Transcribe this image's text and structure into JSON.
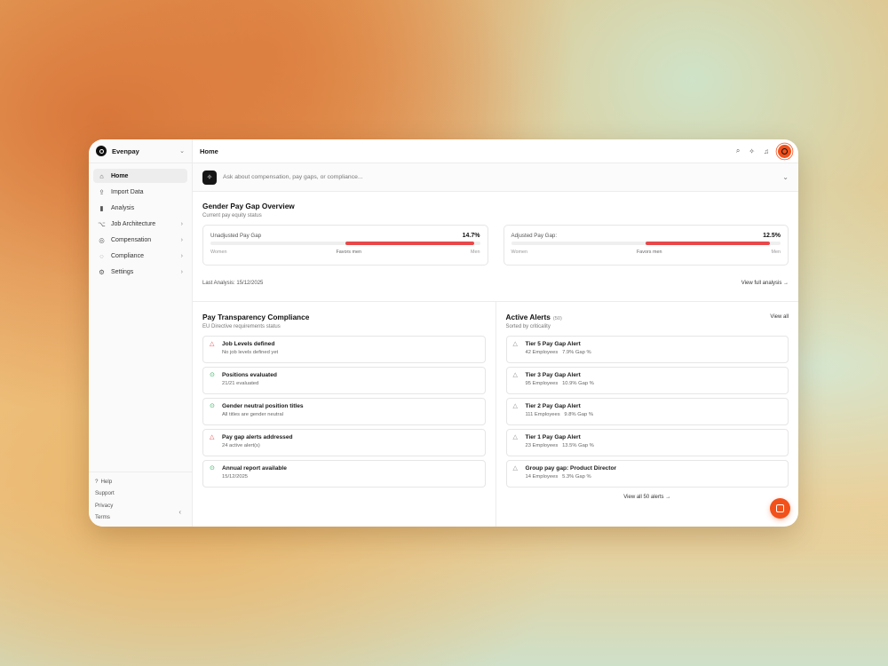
{
  "brand": {
    "name": "Evenpay"
  },
  "sidebar": {
    "items": [
      {
        "label": "Home",
        "icon": "home-icon",
        "glyph": "⌂",
        "active": true,
        "has_children": false
      },
      {
        "label": "Import Data",
        "icon": "upload-icon",
        "glyph": "⇪",
        "active": false,
        "has_children": false
      },
      {
        "label": "Analysis",
        "icon": "bar-chart-icon",
        "glyph": "▮",
        "active": false,
        "has_children": false
      },
      {
        "label": "Job Architecture",
        "icon": "flow-icon",
        "glyph": "⌥",
        "active": false,
        "has_children": true
      },
      {
        "label": "Compensation",
        "icon": "coin-icon",
        "glyph": "◎",
        "active": false,
        "has_children": true
      },
      {
        "label": "Compliance",
        "icon": "check-circle-icon",
        "glyph": "◌",
        "active": false,
        "has_children": true
      },
      {
        "label": "Settings",
        "icon": "gear-icon",
        "glyph": "⚙",
        "active": false,
        "has_children": true
      }
    ],
    "footer": {
      "help": "Help",
      "support": "Support",
      "privacy": "Privacy",
      "terms": "Terms"
    }
  },
  "header": {
    "title": "Home"
  },
  "ask": {
    "placeholder": "Ask about compensation, pay gaps, or compliance..."
  },
  "overview": {
    "title": "Gender Pay Gap Overview",
    "subtitle": "Current pay equity status",
    "cards": [
      {
        "label": "Unadjusted Pay Gap",
        "value": "14.7%",
        "fill_from": 0.5,
        "fill_to": 0.98,
        "left": "Women",
        "mid": "Favors men",
        "right": "Men"
      },
      {
        "label": "Adjusted Pay Gap:",
        "value": "12.5%",
        "fill_from": 0.5,
        "fill_to": 0.96,
        "left": "Women",
        "mid": "Favors men",
        "right": "Men"
      }
    ],
    "last_analysis": "Last Analysis: 15/12/2025",
    "view_full": "View full analysis →"
  },
  "compliance": {
    "title": "Pay Transparency Compliance",
    "subtitle": "EU Directive requirements status",
    "items": [
      {
        "title": "Job Levels defined",
        "sub": "No job levels defined yet",
        "status": "warn"
      },
      {
        "title": "Positions evaluated",
        "sub": "21/21 evaluated",
        "status": "ok"
      },
      {
        "title": "Gender neutral position titles",
        "sub": "All titles are gender neutral",
        "status": "ok"
      },
      {
        "title": "Pay gap alerts addressed",
        "sub": "24 active alert(s)",
        "status": "warn"
      },
      {
        "title": "Annual report available",
        "sub": "15/12/2025",
        "status": "ok"
      }
    ]
  },
  "alerts": {
    "title": "Active Alerts",
    "count": "(50)",
    "subtitle": "Sorted by criticality",
    "view_all": "View all",
    "items": [
      {
        "title": "Tier 5 Pay Gap Alert",
        "sub": "42 Employees   7.9% Gap %"
      },
      {
        "title": "Tier 3 Pay Gap Alert",
        "sub": "95 Employees   10.9% Gap %"
      },
      {
        "title": "Tier 2 Pay Gap Alert",
        "sub": "111 Employees   9.8% Gap %"
      },
      {
        "title": "Tier 1 Pay Gap Alert",
        "sub": "23 Employees   13.5% Gap %"
      },
      {
        "title": "Group pay gap: Product Director",
        "sub": "14 Employees   5.3% Gap %"
      }
    ],
    "view_all_footer": "View all 50 alerts →"
  },
  "colors": {
    "accent": "#f2511b",
    "danger": "#e8484a",
    "success": "#2fae5f"
  }
}
